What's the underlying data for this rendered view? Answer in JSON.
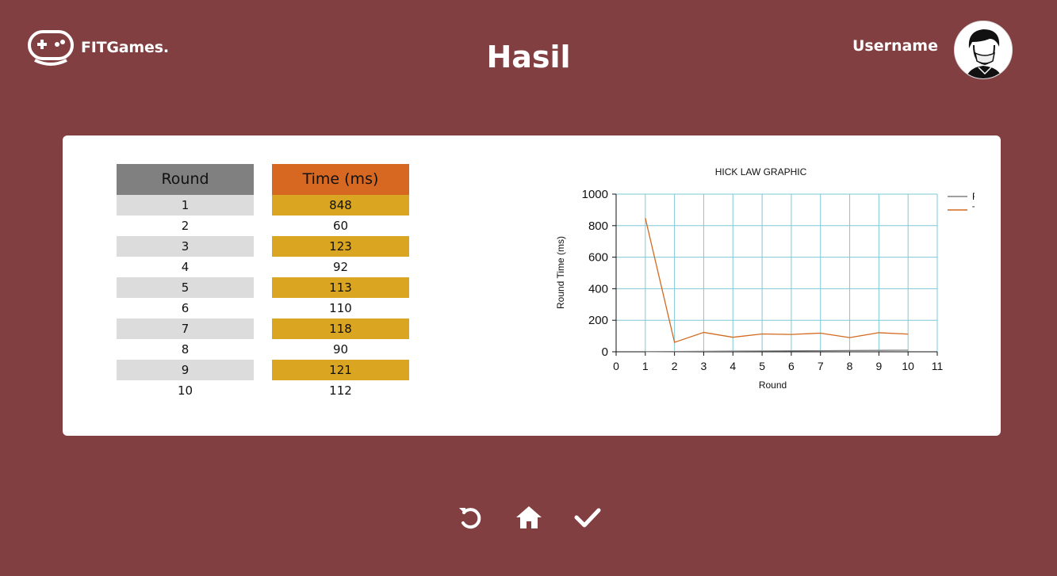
{
  "header": {
    "logo_text": "FITGames.",
    "page_title": "Hasil",
    "username": "Username"
  },
  "table": {
    "headers": {
      "round": "Round",
      "time": "Time (ms)"
    },
    "rounds": [
      "1",
      "2",
      "3",
      "4",
      "5",
      "6",
      "7",
      "8",
      "9",
      "10"
    ],
    "times": [
      "848",
      "60",
      "123",
      "92",
      "113",
      "110",
      "118",
      "90",
      "121",
      "112"
    ]
  },
  "chart_data": {
    "type": "line",
    "title": "HICK LAW GRAPHIC",
    "xlabel": "Round",
    "ylabel": "Round Time (ms)",
    "xlim": [
      0,
      11
    ],
    "ylim": [
      0,
      1000
    ],
    "xticks": [
      "0",
      "1",
      "2",
      "3",
      "4",
      "5",
      "6",
      "7",
      "8",
      "9",
      "10",
      "11"
    ],
    "yticks": [
      "0",
      "200",
      "400",
      "600",
      "800",
      "1000"
    ],
    "grid": true,
    "legend_position": "top-right",
    "x": [
      1,
      2,
      3,
      4,
      5,
      6,
      7,
      8,
      9,
      10
    ],
    "series": [
      {
        "name": "Round",
        "color": "#808080",
        "values": [
          1,
          2,
          3,
          4,
          5,
          6,
          7,
          8,
          9,
          10
        ]
      },
      {
        "name": "Times",
        "color": "#d2691e",
        "values": [
          848,
          60,
          123,
          92,
          113,
          110,
          118,
          90,
          121,
          112
        ]
      }
    ]
  },
  "colors": {
    "background": "#823f41",
    "round_header": "#808080",
    "time_header": "#d66821",
    "time_highlight": "#daa520",
    "grid": "#7ec8d8"
  },
  "controls": {
    "icons": [
      "retry-icon",
      "home-icon",
      "check-icon"
    ]
  }
}
